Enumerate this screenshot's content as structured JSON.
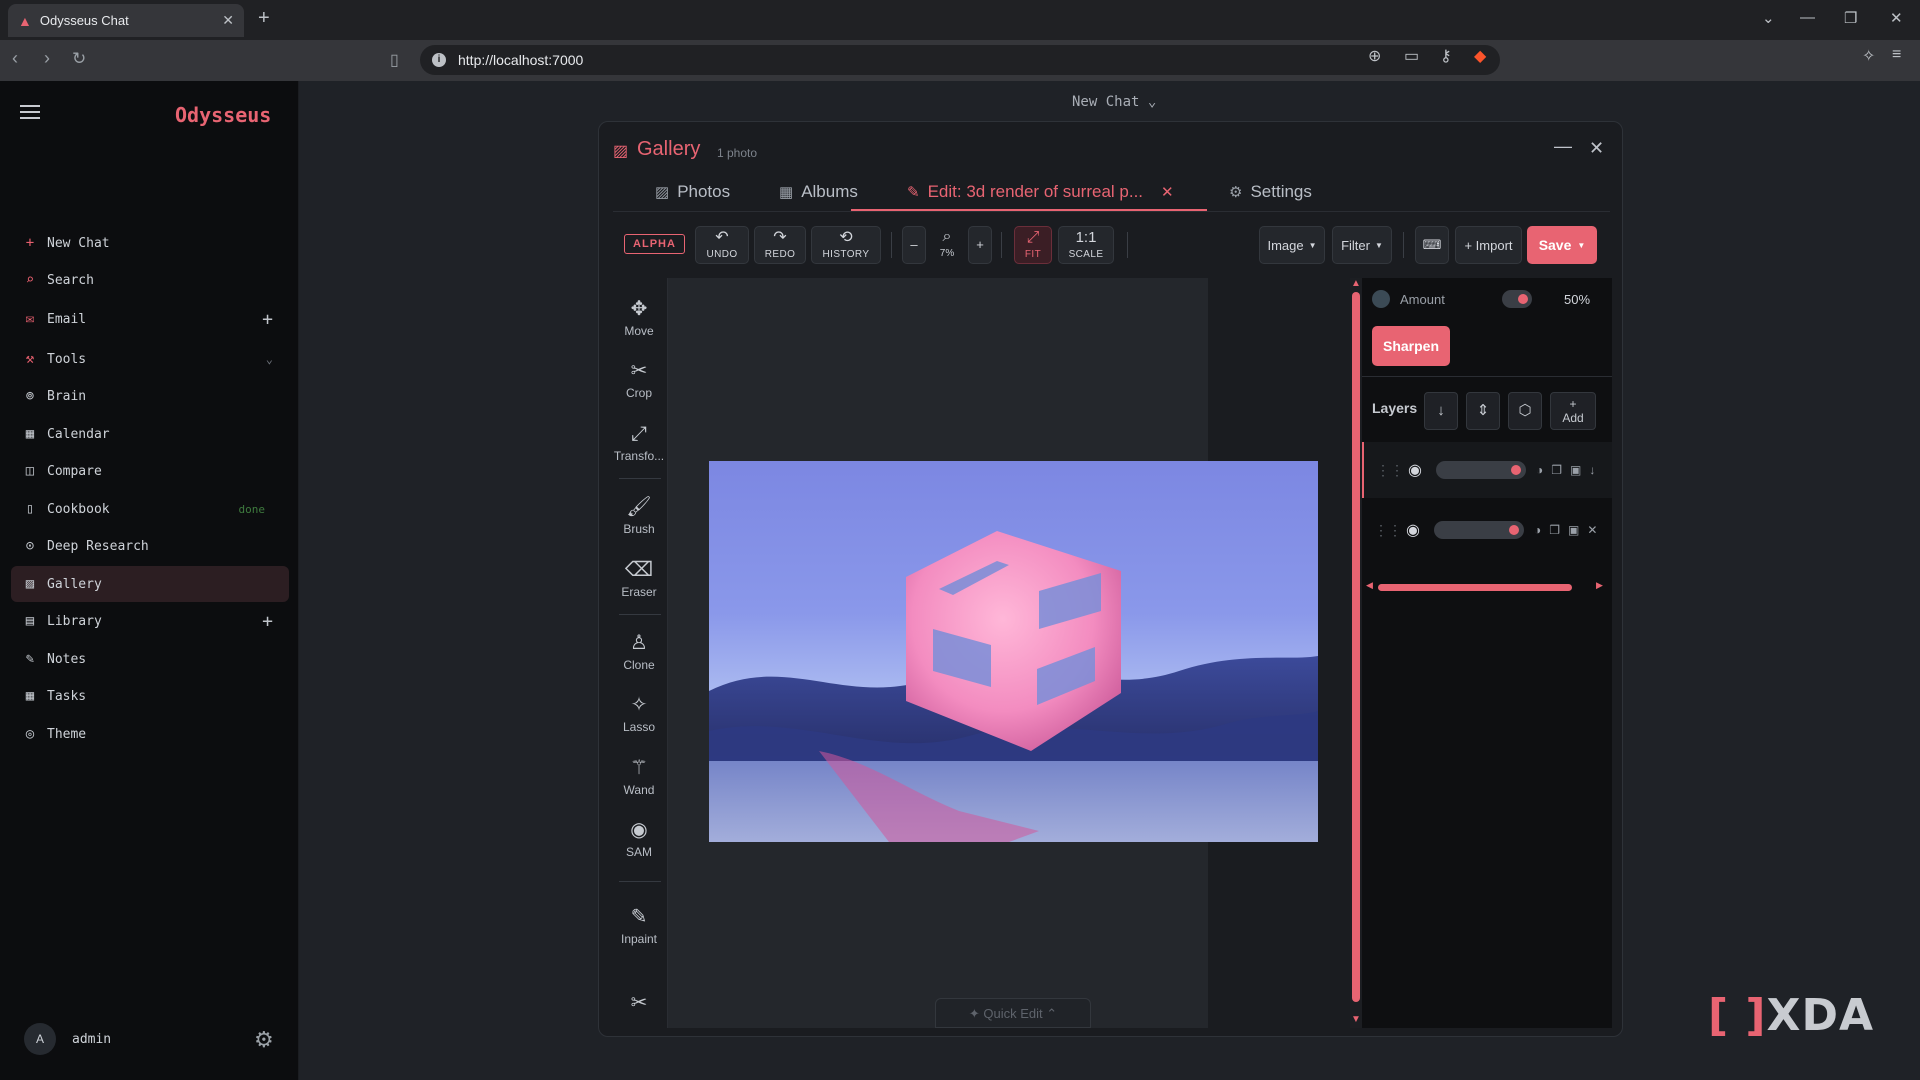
{
  "browser": {
    "tab_title": "Odysseus Chat",
    "url": "http://localhost:7000"
  },
  "sidebar": {
    "brand": "Odysseus",
    "items": [
      {
        "label": "New Chat",
        "icon": "plus-icon"
      },
      {
        "label": "Search",
        "icon": "search-icon"
      },
      {
        "label": "Email",
        "icon": "mail-icon"
      },
      {
        "label": "Tools",
        "icon": "wrench-icon"
      },
      {
        "label": "Brain",
        "icon": "brain-icon"
      },
      {
        "label": "Calendar",
        "icon": "calendar-icon"
      },
      {
        "label": "Compare",
        "icon": "compare-icon"
      },
      {
        "label": "Cookbook",
        "icon": "book-icon",
        "badge": "done"
      },
      {
        "label": "Deep Research",
        "icon": "research-icon"
      },
      {
        "label": "Gallery",
        "icon": "image-icon",
        "active": true
      },
      {
        "label": "Library",
        "icon": "library-icon"
      },
      {
        "label": "Notes",
        "icon": "notes-icon"
      },
      {
        "label": "Tasks",
        "icon": "tasks-icon"
      },
      {
        "label": "Theme",
        "icon": "palette-icon"
      }
    ],
    "user": {
      "initial": "A",
      "name": "admin"
    }
  },
  "header": {
    "chat_title": "New Chat"
  },
  "gallery": {
    "title": "Gallery",
    "count": "1 photo",
    "tabs": {
      "photos": "Photos",
      "albums": "Albums",
      "edit": "Edit: 3d render of surreal p...",
      "settings": "Settings"
    },
    "toolbar": {
      "alpha": "ALPHA",
      "undo": "UNDO",
      "redo": "REDO",
      "history": "HISTORY",
      "zoom_out": "–",
      "zoom_level": "7%",
      "zoom_in": "+",
      "fit": "FIT",
      "scale_ratio": "1:1",
      "scale": "SCALE",
      "image_menu": "Image",
      "filter_menu": "Filter",
      "import": "+ Import",
      "save": "Save"
    },
    "tools": [
      "Move",
      "Crop",
      "Transfo...",
      "Brush",
      "Eraser",
      "Clone",
      "Lasso",
      "Wand",
      "SAM",
      "Inpaint"
    ],
    "quick_edit": "✦ Quick Edit ⌃",
    "panel": {
      "amount_label": "Amount",
      "amount_value": "50%",
      "sharpen": "Sharpen",
      "layers_label": "Layers",
      "add_plus": "+",
      "add_label": "Add"
    }
  },
  "accent_color": "#e86472",
  "watermark": "XDA"
}
